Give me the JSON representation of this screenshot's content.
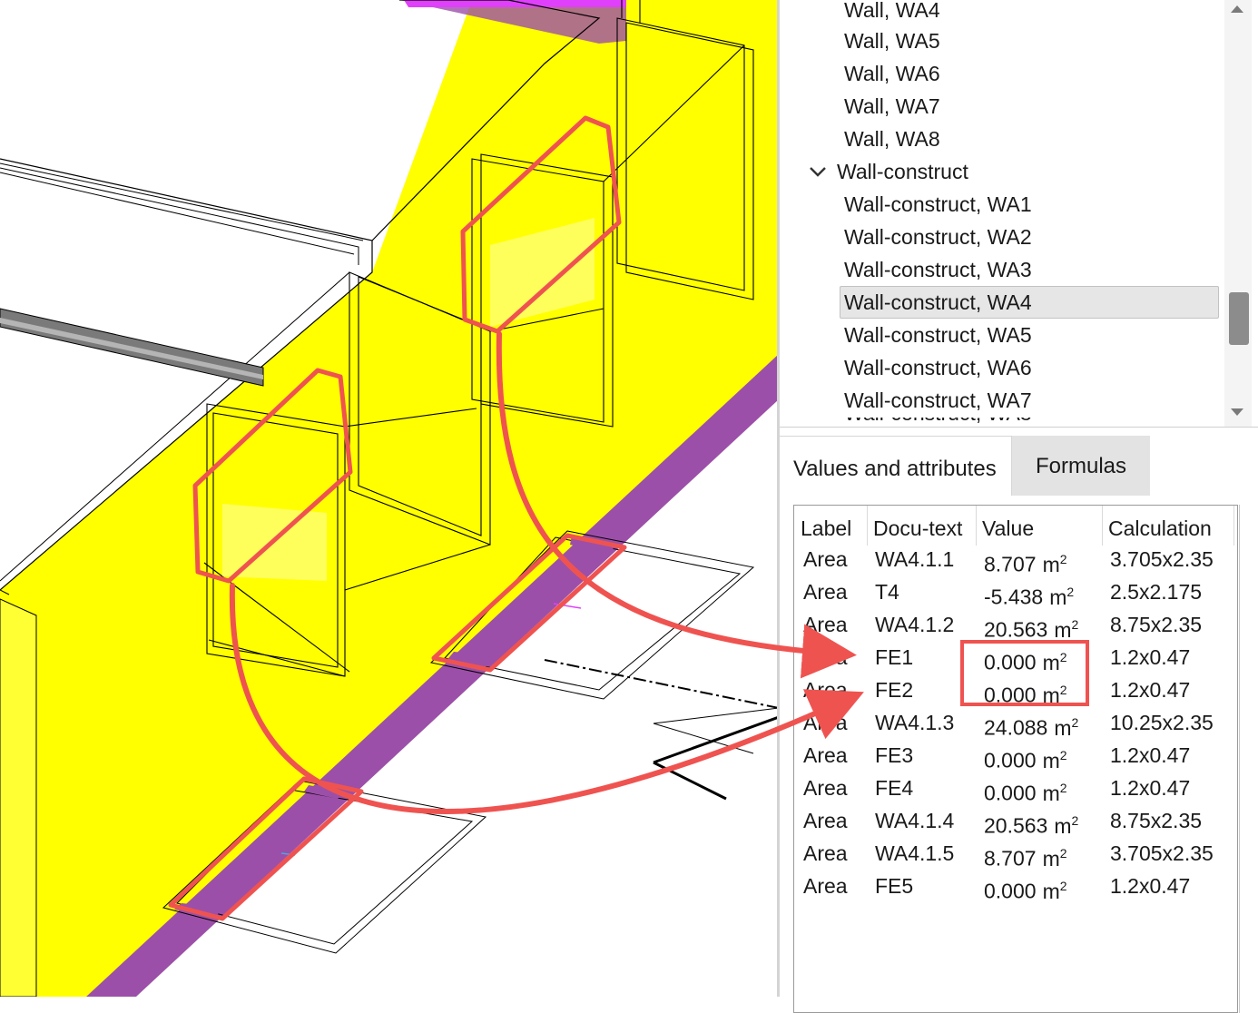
{
  "tree": {
    "items": [
      {
        "label": "Wall, WA4",
        "type": "child"
      },
      {
        "label": "Wall, WA5",
        "type": "child"
      },
      {
        "label": "Wall, WA6",
        "type": "child"
      },
      {
        "label": "Wall, WA7",
        "type": "child"
      },
      {
        "label": "Wall, WA8",
        "type": "child"
      },
      {
        "label": "Wall-construct",
        "type": "group",
        "expanded": true
      },
      {
        "label": "Wall-construct, WA1",
        "type": "child"
      },
      {
        "label": "Wall-construct, WA2",
        "type": "child"
      },
      {
        "label": "Wall-construct, WA3",
        "type": "child"
      },
      {
        "label": "Wall-construct, WA4",
        "type": "child",
        "selected": true
      },
      {
        "label": "Wall-construct, WA5",
        "type": "child"
      },
      {
        "label": "Wall-construct, WA6",
        "type": "child"
      },
      {
        "label": "Wall-construct, WA7",
        "type": "child"
      }
    ]
  },
  "tabs": {
    "values_label": "Values and attributes",
    "formulas_label": "Formulas",
    "active": "formulas"
  },
  "table": {
    "headers": {
      "label": "Label",
      "docu": "Docu-text",
      "value": "Value",
      "calc": "Calculation"
    },
    "rows": [
      {
        "label": "Area",
        "docu": "WA4.1.1",
        "value": "8.707",
        "calc": "3.705x2.35"
      },
      {
        "label": "Area",
        "docu": "T4",
        "value": "-5.438",
        "calc": "2.5x2.175"
      },
      {
        "label": "Area",
        "docu": "WA4.1.2",
        "value": "20.563",
        "calc": "8.75x2.35"
      },
      {
        "label": "Area",
        "docu": "FE1",
        "value": "0.000",
        "calc": "1.2x0.47"
      },
      {
        "label": "Area",
        "docu": "FE2",
        "value": "0.000",
        "calc": "1.2x0.47"
      },
      {
        "label": "Area",
        "docu": "WA4.1.3",
        "value": "24.088",
        "calc": "10.25x2.35"
      },
      {
        "label": "Area",
        "docu": "FE3",
        "value": "0.000",
        "calc": "1.2x0.47"
      },
      {
        "label": "Area",
        "docu": "FE4",
        "value": "0.000",
        "calc": "1.2x0.47"
      },
      {
        "label": "Area",
        "docu": "WA4.1.4",
        "value": "20.563",
        "calc": "8.75x2.35"
      },
      {
        "label": "Area",
        "docu": "WA4.1.5",
        "value": "8.707",
        "calc": "3.705x2.35"
      },
      {
        "label": "Area",
        "docu": "FE5",
        "value": "0.000",
        "calc": "1.2x0.47"
      }
    ],
    "unit": "m",
    "unit_exp": "2"
  },
  "colors": {
    "wall_yellow": "#ffff00",
    "wall_yellow_light": "#ffff66",
    "purple": "#9c4fa8",
    "magenta": "#e040fb",
    "annotation_red": "#ef5350",
    "selected_row": "#e6e6e6",
    "active_tab": "#e3e3e3"
  }
}
